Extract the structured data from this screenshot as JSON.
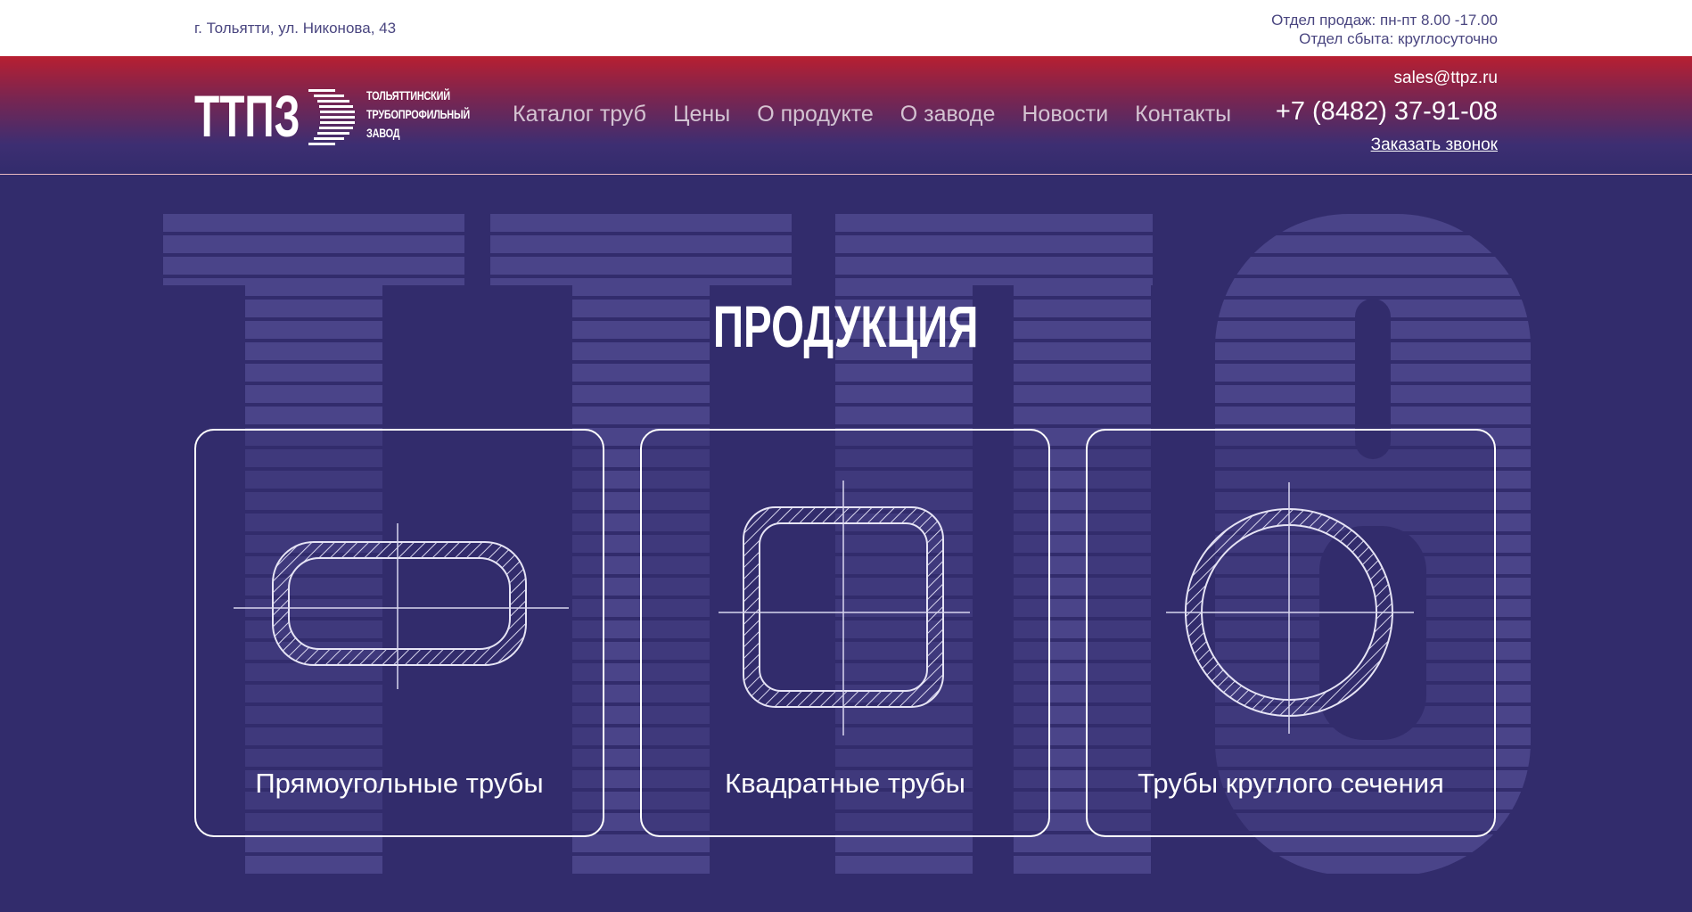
{
  "topbar": {
    "address": "г. Тольятти, ул. Никонова, 43",
    "sales_hours": "Отдел продаж: пн-пт 8.00 -17.00",
    "dispatch_hours": "Отдел сбыта: круглосуточно"
  },
  "logo": {
    "mark_text": "ТТПЗ",
    "tagline_line1": "Тольяттинский",
    "tagline_line2": "трубопрофильный",
    "tagline_line3": "завод"
  },
  "nav": {
    "items": [
      {
        "label": "Каталог труб"
      },
      {
        "label": "Цены"
      },
      {
        "label": "О продукте"
      },
      {
        "label": "О заводе"
      },
      {
        "label": "Новости"
      },
      {
        "label": "Контакты"
      }
    ]
  },
  "contacts": {
    "email": "sales@ttpz.ru",
    "phone": "+7 (8482) 37-91-08",
    "callback_label": "Заказать звонок"
  },
  "products": {
    "title": "ПРОДУКЦИЯ",
    "cards": [
      {
        "label": "Прямоугольные трубы",
        "icon": "rectangular-pipe-icon"
      },
      {
        "label": "Квадратные трубы",
        "icon": "square-pipe-icon"
      },
      {
        "label": "Трубы круглого сечения",
        "icon": "round-pipe-icon"
      }
    ]
  },
  "colors": {
    "background": "#322c6c",
    "header_top": "#b81f31",
    "text_light": "#ffffff",
    "topbar_text": "#4a4680"
  }
}
